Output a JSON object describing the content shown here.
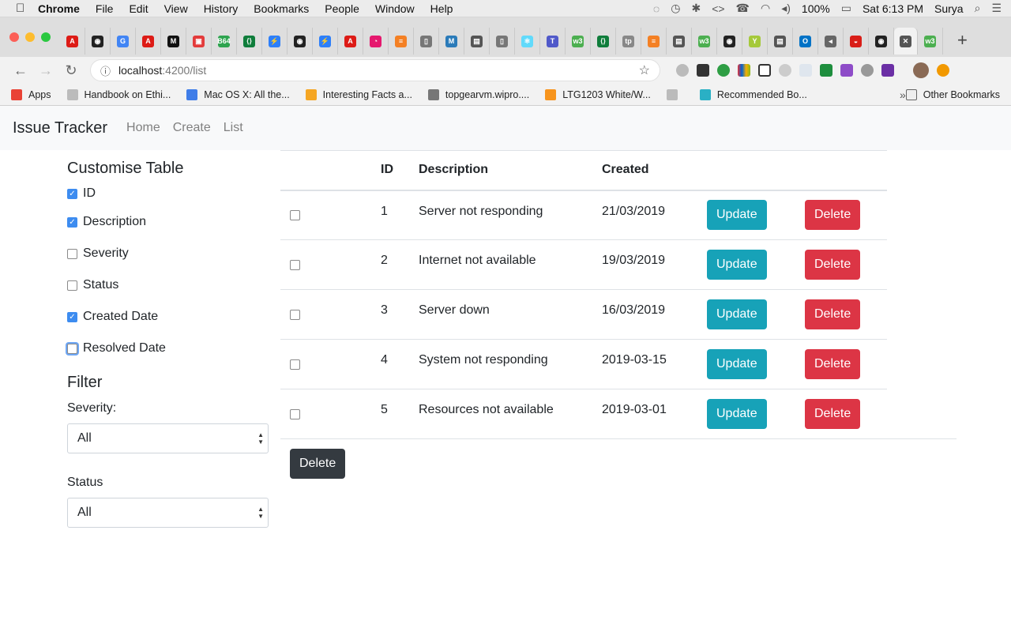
{
  "menubar": {
    "app": "Chrome",
    "items": [
      "File",
      "Edit",
      "View",
      "History",
      "Bookmarks",
      "People",
      "Window",
      "Help"
    ],
    "battery": "100%",
    "clock": "Sat 6:13 PM",
    "user": "Surya"
  },
  "tabs": [
    {
      "label": "A",
      "color": "#dd1b16"
    },
    {
      "label": "◉",
      "color": "#222222"
    },
    {
      "label": "G",
      "color": "#4285f4"
    },
    {
      "label": "A",
      "color": "#dd1b16"
    },
    {
      "label": "M",
      "color": "#111111"
    },
    {
      "label": "▣",
      "color": "#e33b3b"
    },
    {
      "label": "B64",
      "color": "#2ea44f"
    },
    {
      "label": "⟨⟩",
      "color": "#0f7d3b"
    },
    {
      "label": "⚡",
      "color": "#2d7ff9"
    },
    {
      "label": "◉",
      "color": "#222222"
    },
    {
      "label": "⚡",
      "color": "#2d7ff9"
    },
    {
      "label": "A",
      "color": "#dd1b16"
    },
    {
      "label": "◔",
      "color": "#e5186e"
    },
    {
      "label": "≡",
      "color": "#f48024"
    },
    {
      "label": "▯",
      "color": "#777777"
    },
    {
      "label": "M",
      "color": "#2b7bb9"
    },
    {
      "label": "▤",
      "color": "#555555"
    },
    {
      "label": "▯",
      "color": "#777777"
    },
    {
      "label": "⚛",
      "color": "#61dafb"
    },
    {
      "label": "T",
      "color": "#5059c9"
    },
    {
      "label": "w3",
      "color": "#4caf50"
    },
    {
      "label": "⟨⟩",
      "color": "#0f7d3b"
    },
    {
      "label": "tp",
      "color": "#888888"
    },
    {
      "label": "≡",
      "color": "#f48024"
    },
    {
      "label": "▤",
      "color": "#555555"
    },
    {
      "label": "w3",
      "color": "#4caf50"
    },
    {
      "label": "◉",
      "color": "#222222"
    },
    {
      "label": "Y",
      "color": "#a5c93a"
    },
    {
      "label": "▤",
      "color": "#555555"
    },
    {
      "label": "O",
      "color": "#0072c6"
    },
    {
      "label": "◂",
      "color": "#666666"
    },
    {
      "label": "◒",
      "color": "#d91e18"
    },
    {
      "label": "◉",
      "color": "#222222"
    },
    {
      "label": "✕",
      "color": "#555555"
    },
    {
      "label": "w3",
      "color": "#4caf50"
    }
  ],
  "address": {
    "host": "localhost",
    "path": ":4200/list"
  },
  "bookmarks": [
    {
      "label": "Apps",
      "color": "#e94235"
    },
    {
      "label": "Handbook on Ethi...",
      "color": "#bbbbbb"
    },
    {
      "label": "Mac OS X: All the...",
      "color": "#3f7de8"
    },
    {
      "label": "Interesting Facts a...",
      "color": "#f5a623"
    },
    {
      "label": "topgearvm.wipro....",
      "color": "#777777"
    },
    {
      "label": "LTG1203 White/W...",
      "color": "#f7941d"
    },
    {
      "label": "",
      "color": "#bbbbbb"
    },
    {
      "label": "Recommended Bo...",
      "color": "#2ab0c5"
    }
  ],
  "bookmarks_other": "Other Bookmarks",
  "app": {
    "brand": "Issue Tracker",
    "nav": [
      "Home",
      "Create",
      "List"
    ]
  },
  "sidebar": {
    "title": "Customise Table",
    "columns": [
      {
        "label": "ID",
        "checked": true
      },
      {
        "label": "Description",
        "checked": true
      },
      {
        "label": "Severity",
        "checked": false
      },
      {
        "label": "Status",
        "checked": false
      },
      {
        "label": "Created Date",
        "checked": true
      },
      {
        "label": "Resolved Date",
        "checked": false,
        "focused": true
      }
    ],
    "filter_title": "Filter",
    "severity_label": "Severity:",
    "severity_value": "All",
    "status_label": "Status",
    "status_value": "All"
  },
  "table": {
    "headers": [
      "",
      "ID",
      "Description",
      "Created",
      "",
      ""
    ],
    "rows": [
      {
        "id": "1",
        "description": "Server not responding",
        "created": "21/03/2019"
      },
      {
        "id": "2",
        "description": "Internet not available",
        "created": "19/03/2019"
      },
      {
        "id": "3",
        "description": "Server down",
        "created": "16/03/2019"
      },
      {
        "id": "4",
        "description": "System not responding",
        "created": "2019-03-15"
      },
      {
        "id": "5",
        "description": "Resources not available",
        "created": "2019-03-01"
      }
    ],
    "update_label": "Update",
    "delete_label": "Delete",
    "bulk_delete_label": "Delete"
  }
}
